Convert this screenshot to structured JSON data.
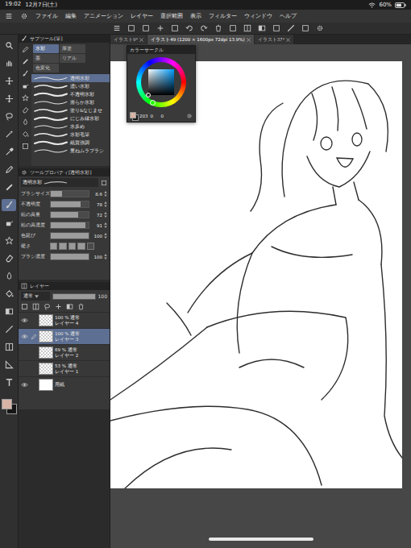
{
  "status_bar": {
    "time": "19:02",
    "date": "12月7日(土)",
    "battery": "60%"
  },
  "menu": [
    "ファイル",
    "編集",
    "アニメーション",
    "レイヤー",
    "選択範囲",
    "表示",
    "フィルター",
    "ウィンドウ",
    "ヘルプ"
  ],
  "tabs": [
    {
      "label": "イラスト9*",
      "selected": false
    },
    {
      "label": "イラスト49 (1200 × 1600px 72dpi 13.9%)",
      "selected": true
    },
    {
      "label": "イラスト37*",
      "selected": false
    }
  ],
  "toolbar": {
    "tools": [
      {
        "selected": false
      },
      {
        "selected": false
      },
      {
        "selected": false
      },
      {
        "selected": false
      },
      {
        "selected": false
      },
      {
        "selected": false
      },
      {
        "selected": false
      },
      {
        "selected": false
      },
      {
        "selected": false
      },
      {
        "selected": true
      },
      {
        "selected": false
      },
      {
        "selected": false
      },
      {
        "selected": false
      },
      {
        "selected": false
      },
      {
        "selected": false
      },
      {
        "selected": false
      },
      {
        "selected": false
      },
      {
        "selected": false
      },
      {
        "selected": false
      },
      {
        "selected": false
      }
    ]
  },
  "swatches": [
    {
      "name": "main",
      "color": "#d8b4a6"
    },
    {
      "name": "sub",
      "color": "#161616"
    }
  ],
  "sub_tool": {
    "title": "サブツール[筆]",
    "groups": [
      {
        "label": "水彩",
        "selected": true
      },
      {
        "label": "厚塗",
        "selected": false
      },
      {
        "label": "墨",
        "selected": false
      },
      {
        "label": "リアル",
        "selected": false
      },
      {
        "label": "色変化",
        "selected": false
      }
    ],
    "items": [
      {
        "label": "透明水彩",
        "selected": true
      },
      {
        "label": "濃い水彩",
        "selected": false
      },
      {
        "label": "不透明水彩",
        "selected": false
      },
      {
        "label": "滑らか水彩",
        "selected": false
      },
      {
        "label": "塗り&なじませ",
        "selected": false
      },
      {
        "label": "にじみ縁水彩",
        "selected": false
      },
      {
        "label": "水多め",
        "selected": false
      },
      {
        "label": "水彩毛筆",
        "selected": false
      },
      {
        "label": "紙質強調",
        "selected": false
      },
      {
        "label": "重ねムラブラシ",
        "selected": false
      }
    ]
  },
  "tool_property": {
    "title": "ツールプロパティ[透明水彩]",
    "brush_name": "透明水彩",
    "properties": [
      {
        "label": "ブラシサイズ",
        "value": "8.6",
        "level": 0.3,
        "kind": "slider"
      },
      {
        "label": "不透明度",
        "value": "78",
        "level": 0.78,
        "kind": "slider"
      },
      {
        "label": "絵の具量",
        "value": "72",
        "level": 0.72,
        "kind": "slider"
      },
      {
        "label": "絵の具濃度",
        "value": "91",
        "level": 0.91,
        "kind": "slider"
      },
      {
        "label": "色延び",
        "value": "100",
        "level": 1,
        "kind": "slider"
      },
      {
        "label": "硬さ",
        "value": "",
        "level": 0.8,
        "kind": "steps"
      },
      {
        "label": "ブラシ濃度",
        "value": "100",
        "level": 1,
        "kind": "slider"
      }
    ]
  },
  "layers": {
    "title": "レイヤー",
    "blend": "通常",
    "opacity": "100",
    "items": [
      {
        "mode": "100 % 通常",
        "name": "レイヤー 4",
        "visible": true,
        "selected": false,
        "kind": "raster"
      },
      {
        "mode": "100 % 通常",
        "name": "レイヤー 3",
        "visible": true,
        "selected": true,
        "kind": "raster"
      },
      {
        "mode": "69 % 通常",
        "name": "レイヤー 2",
        "visible": false,
        "selected": false,
        "kind": "raster"
      },
      {
        "mode": "53 % 通常",
        "name": "レイヤー 1",
        "visible": false,
        "selected": false,
        "kind": "raster"
      },
      {
        "mode": "",
        "name": "用紙",
        "visible": true,
        "selected": false,
        "kind": "paper"
      }
    ]
  },
  "color_circle": {
    "title": "カラーサークル",
    "values": [
      "203",
      "0",
      "0"
    ]
  }
}
